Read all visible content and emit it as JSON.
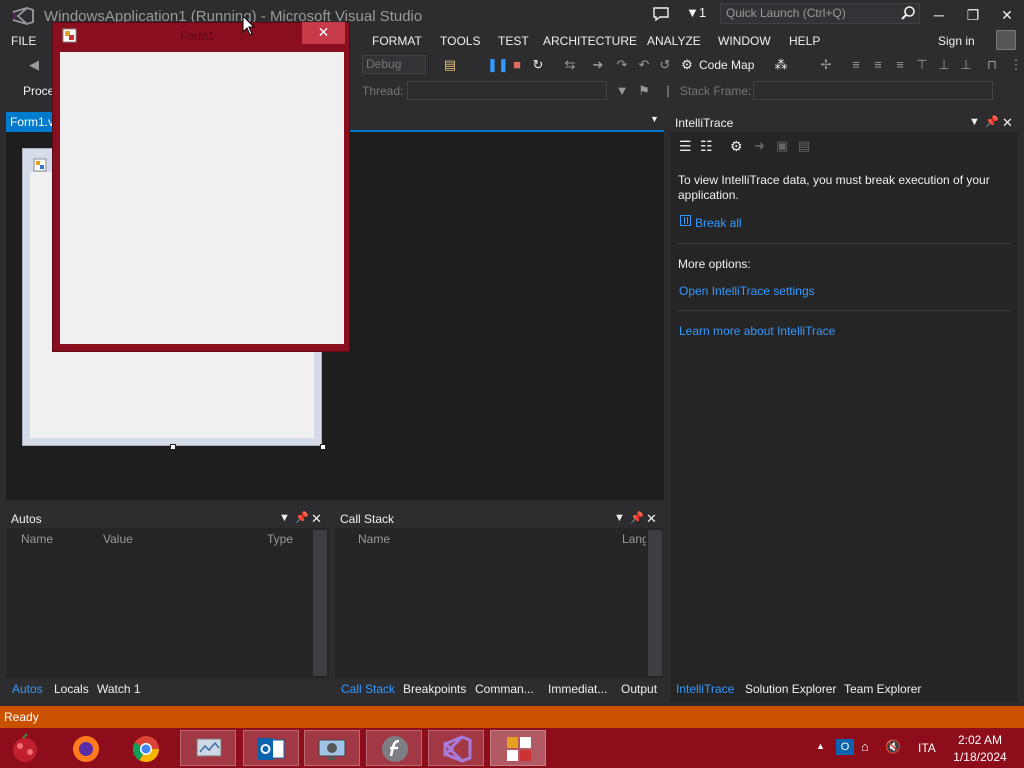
{
  "window": {
    "title": "WindowsApplication1 (Running) - Microsoft Visual Studio",
    "notifications_count": "1",
    "quick_launch_placeholder": "Quick Launch (Ctrl+Q)",
    "sign_in": "Sign in"
  },
  "menu": [
    "FILE",
    "FORMAT",
    "TOOLS",
    "TEST",
    "ARCHITECTURE",
    "ANALYZE",
    "WINDOW",
    "HELP"
  ],
  "toolbar": {
    "configuration": "Debug",
    "code_map_label": "Code Map",
    "process_label": "Proce",
    "thread_label": "Thread:",
    "stack_frame_label": "Stack Frame:"
  },
  "document": {
    "tab_label": "Form1.vb"
  },
  "running_form": {
    "title": "Form1",
    "close_glyph": "✕"
  },
  "intellitrace": {
    "title": "IntelliTrace",
    "message": "To view IntelliTrace data, you must break execution of your application.",
    "break_all": "Break all",
    "more_options": "More options:",
    "open_settings": "Open IntelliTrace settings",
    "learn_more": "Learn more about IntelliTrace"
  },
  "autos_pane": {
    "title": "Autos",
    "columns": [
      "Name",
      "Value",
      "Type"
    ],
    "tabs": [
      "Autos",
      "Locals",
      "Watch 1"
    ],
    "active_tab": 0
  },
  "callstack_pane": {
    "title": "Call Stack",
    "columns": [
      "Name",
      "Lang"
    ],
    "tabs": [
      "Call Stack",
      "Breakpoints",
      "Comman...",
      "Immediat...",
      "Output"
    ],
    "active_tab": 0
  },
  "right_tabs": {
    "tabs": [
      "IntelliTrace",
      "Solution Explorer",
      "Team Explorer"
    ],
    "active_tab": 0
  },
  "status": {
    "text": "Ready"
  },
  "taskbar": {
    "language": "ITA",
    "time": "2:02 AM",
    "date": "1/18/2024"
  },
  "colors": {
    "accent": "#007acc",
    "status_bar": "#ca5100",
    "taskbar": "#8e0d1b",
    "form_frame": "#8a0f1e",
    "link": "#3399ff"
  }
}
